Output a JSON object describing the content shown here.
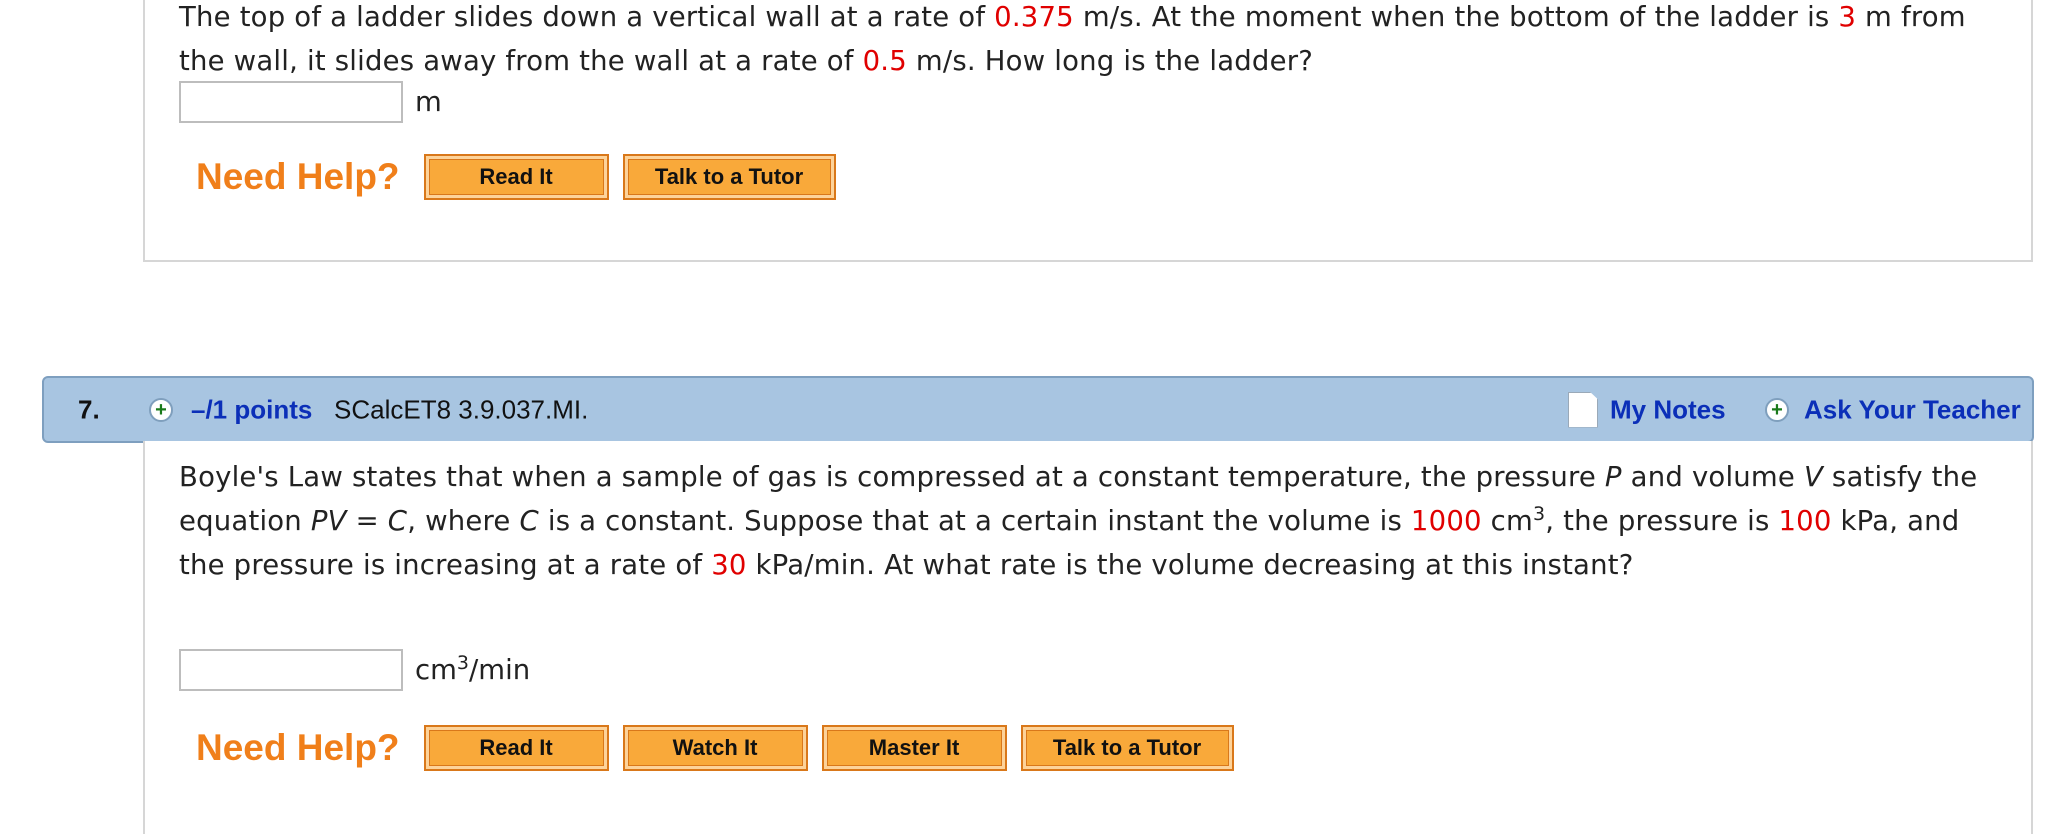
{
  "q6": {
    "text_parts": [
      {
        "t": "The top of a ladder slides down a vertical wall at a rate of "
      },
      {
        "t": "0.375",
        "c": "red"
      },
      {
        "t": " m/s. At the moment when the bottom of the ladder is "
      },
      {
        "t": "3",
        "c": "red"
      },
      {
        "t": " m from the wall, it slides away from the wall at a rate of "
      },
      {
        "t": "0.5",
        "c": "red"
      },
      {
        "t": " m/s. How long is the ladder?"
      }
    ],
    "answer_value": "",
    "unit": "m",
    "help_label": "Need Help?",
    "buttons": [
      "Read It",
      "Talk to a Tutor"
    ]
  },
  "q7": {
    "header": {
      "number": "7.",
      "points": "–/1 points",
      "code": "SCalcET8 3.9.037.MI.",
      "my_notes": "My Notes",
      "ask_teacher": "Ask Your Teacher"
    },
    "text_parts": [
      {
        "t": "Boyle's Law states that when a sample of gas is compressed at a constant temperature, the pressure "
      },
      {
        "t": "P",
        "c": "var"
      },
      {
        "t": " and volume "
      },
      {
        "t": "V",
        "c": "var"
      },
      {
        "t": " satisfy the equation "
      },
      {
        "t": "PV",
        "c": "var"
      },
      {
        "t": " = "
      },
      {
        "t": "C",
        "c": "var"
      },
      {
        "t": ", where "
      },
      {
        "t": "C",
        "c": "var"
      },
      {
        "t": " is a constant. Suppose that at a certain instant the volume is "
      },
      {
        "t": "1000",
        "c": "red"
      },
      {
        "t": " cm"
      },
      {
        "t": "3",
        "c": "sup"
      },
      {
        "t": ", the pressure is "
      },
      {
        "t": "100",
        "c": "red"
      },
      {
        "t": " kPa, and the pressure is increasing at a rate of "
      },
      {
        "t": "30",
        "c": "red"
      },
      {
        "t": " kPa/min. At what rate is the volume decreasing at this instant?"
      }
    ],
    "answer_value": "",
    "unit_prefix": "cm",
    "unit_sup": "3",
    "unit_suffix": "/min",
    "help_label": "Need Help?",
    "buttons": [
      "Read It",
      "Watch It",
      "Master It",
      "Talk to a Tutor"
    ]
  },
  "colors": {
    "highlight": "#e00000",
    "help_orange": "#f07f1a",
    "button_fill": "#f9a93a",
    "header_bg": "#a8c5e1",
    "link_blue": "#0b2fb8"
  },
  "icons": [
    "plus-circle-icon",
    "notes-page-icon"
  ]
}
